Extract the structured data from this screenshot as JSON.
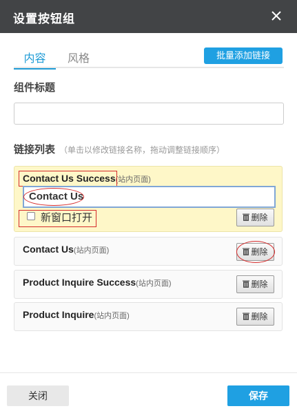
{
  "dialog": {
    "title": "设置按钮组"
  },
  "tabs": [
    {
      "label": "内容",
      "active": true
    },
    {
      "label": "风格",
      "active": false
    }
  ],
  "bulk_add_label": "批量添加链接",
  "component_title_label": "组件标题",
  "component_title_value": "",
  "link_list": {
    "label": "链接列表",
    "hint": "（单击以修改链接名称，拖动调整链接顺序）",
    "items": [
      {
        "name": "Contact Us Success",
        "tag": "(站内页面)",
        "expanded": true,
        "edit_value": "Contact Us",
        "new_window_label": "新窗口打开",
        "new_window_checked": false,
        "delete_label": "删除"
      },
      {
        "name": "Contact Us",
        "tag": "(站内页面)",
        "delete_label": "删除"
      },
      {
        "name": "Product Inquire Success",
        "tag": "(站内页面)",
        "delete_label": "删除"
      },
      {
        "name": "Product Inquire",
        "tag": "(站内页面)",
        "delete_label": "删除"
      }
    ]
  },
  "footer": {
    "close_label": "关闭",
    "save_label": "保存"
  },
  "colors": {
    "header_bg": "#424446",
    "accent": "#1fa0e2",
    "expanded_bg": "#fef7c8",
    "annotation": "#d52a2a"
  }
}
